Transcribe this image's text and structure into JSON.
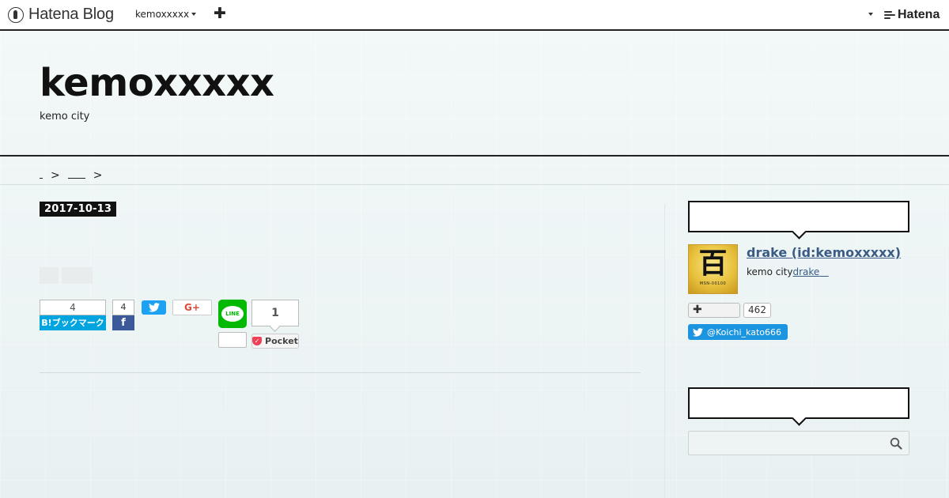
{
  "topbar": {
    "logo_text": "Hatena Blog",
    "blog_menu_label": "kemoxxxxx",
    "add_label": "✚",
    "brand_label": "Hatena"
  },
  "header": {
    "title": "kemoxxxxx",
    "description": "kemo city"
  },
  "breadcrumb": {
    "separator_1": ">",
    "separator_2": ">"
  },
  "entry": {
    "date": "2017-10-13"
  },
  "share": {
    "hatena_count": "4",
    "hatena_label": "B!ブックマーク",
    "facebook_count": "4",
    "facebook_label": "f",
    "googleplus_label": "G+",
    "line_label": "LINE",
    "pocket_count": "1",
    "pocket_label": "Pocket"
  },
  "sidebar": {
    "profile": {
      "avatar_glyph": "百",
      "avatar_caption": "MSN-00100",
      "name": "drake (id:kemoxxxxx)",
      "description": "kemo city",
      "link_text": "drake",
      "follow_label": "✚",
      "follower_count": "462",
      "twitter_label": "@Koichi_kato666"
    }
  },
  "colors": {
    "hatena_blue": "#00a4de",
    "facebook_blue": "#3b5998",
    "twitter_blue": "#1da1f2",
    "line_green": "#00b900",
    "pocket_red": "#ee4056",
    "profile_link": "#3a5b85"
  },
  "icons": {
    "logo": "hatena-blog-logo-icon",
    "twitter": "twitter-bird-icon",
    "search": "magnifier-icon"
  }
}
